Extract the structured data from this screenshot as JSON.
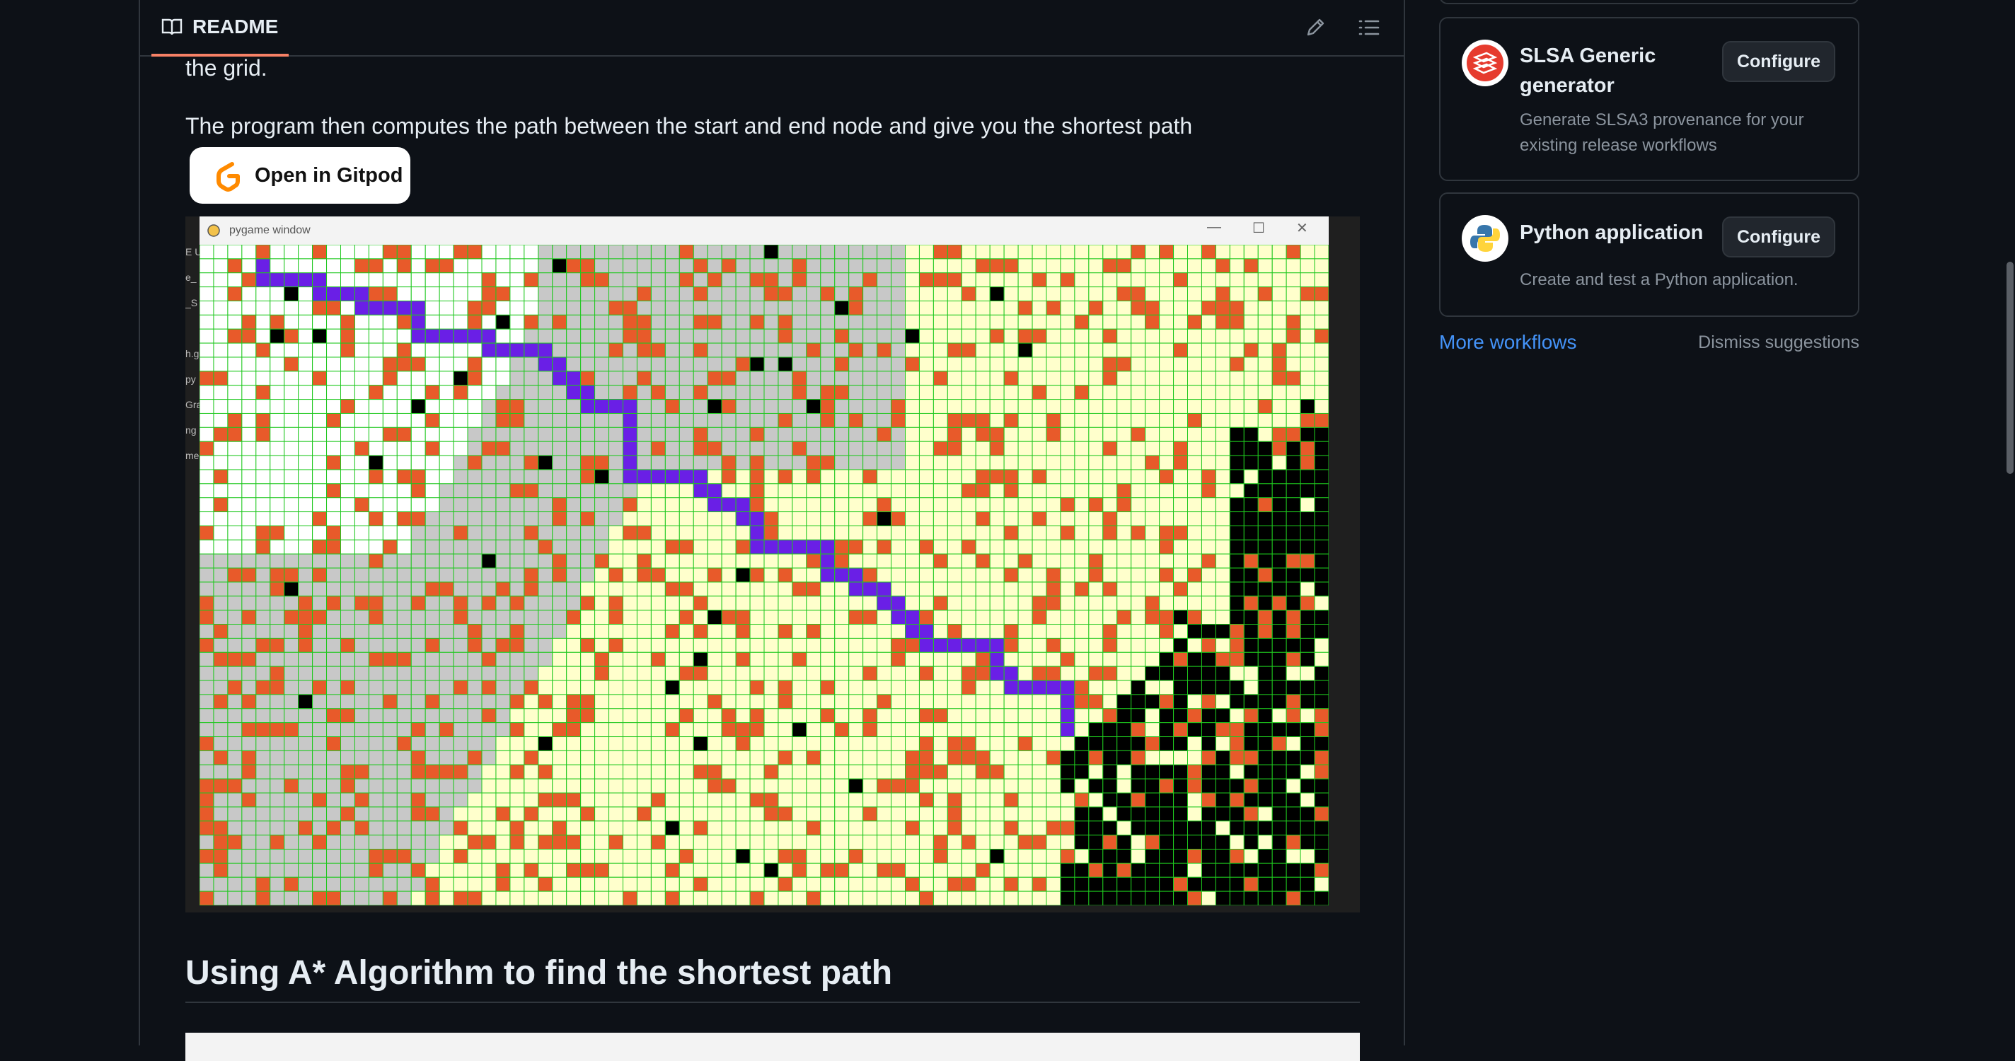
{
  "readme": {
    "tab_label": "README",
    "para1": "the grid.",
    "para2": "The program then computes the path between the start and end node and give you the shortest path",
    "gitpod_label": "Open in Gitpod",
    "screenshot": {
      "window_title": "pygame window",
      "side_labels": [
        "E U",
        "e_",
        "_S",
        "",
        "h.g",
        "py",
        "Gra",
        "ng",
        "me"
      ],
      "cols": 80,
      "rows": 47,
      "colors": {
        "open": "#ffffcc",
        "unvisited": "#ffffff",
        "visited": "#c8c8c8",
        "barrier": "#e85a2a",
        "closed": "#000000",
        "path": "#6a1fe6",
        "gridline": "#1ec81e"
      },
      "path_cells": [
        [
          4,
          1
        ],
        [
          4,
          2
        ],
        [
          5,
          2
        ],
        [
          6,
          2
        ],
        [
          7,
          2
        ],
        [
          8,
          2
        ],
        [
          8,
          3
        ],
        [
          9,
          3
        ],
        [
          10,
          3
        ],
        [
          11,
          3
        ],
        [
          11,
          4
        ],
        [
          12,
          4
        ],
        [
          13,
          4
        ],
        [
          14,
          4
        ],
        [
          15,
          4
        ],
        [
          15,
          5
        ],
        [
          15,
          6
        ],
        [
          16,
          6
        ],
        [
          17,
          6
        ],
        [
          18,
          6
        ],
        [
          19,
          6
        ],
        [
          20,
          6
        ],
        [
          20,
          7
        ],
        [
          21,
          7
        ],
        [
          22,
          7
        ],
        [
          23,
          7
        ],
        [
          24,
          7
        ],
        [
          24,
          8
        ],
        [
          25,
          8
        ],
        [
          25,
          9
        ],
        [
          26,
          9
        ],
        [
          26,
          10
        ],
        [
          27,
          10
        ],
        [
          27,
          11
        ],
        [
          28,
          11
        ],
        [
          29,
          11
        ],
        [
          30,
          11
        ],
        [
          30,
          12
        ],
        [
          30,
          13
        ],
        [
          30,
          14
        ],
        [
          30,
          15
        ],
        [
          30,
          16
        ],
        [
          31,
          16
        ],
        [
          32,
          16
        ],
        [
          33,
          16
        ],
        [
          34,
          16
        ],
        [
          35,
          16
        ],
        [
          35,
          17
        ],
        [
          36,
          17
        ],
        [
          36,
          18
        ],
        [
          37,
          18
        ],
        [
          38,
          18
        ],
        [
          38,
          19
        ],
        [
          39,
          19
        ],
        [
          39,
          20
        ],
        [
          39,
          21
        ],
        [
          40,
          21
        ],
        [
          41,
          21
        ],
        [
          42,
          21
        ],
        [
          43,
          21
        ],
        [
          44,
          21
        ],
        [
          44,
          22
        ],
        [
          44,
          23
        ],
        [
          45,
          23
        ],
        [
          46,
          23
        ],
        [
          46,
          24
        ],
        [
          47,
          24
        ],
        [
          48,
          24
        ],
        [
          48,
          25
        ],
        [
          49,
          25
        ],
        [
          49,
          26
        ],
        [
          50,
          26
        ],
        [
          50,
          27
        ],
        [
          51,
          27
        ],
        [
          51,
          28
        ],
        [
          52,
          28
        ],
        [
          53,
          28
        ],
        [
          54,
          28
        ],
        [
          55,
          28
        ],
        [
          56,
          28
        ],
        [
          56,
          29
        ],
        [
          56,
          30
        ],
        [
          57,
          30
        ],
        [
          57,
          31
        ],
        [
          58,
          31
        ],
        [
          59,
          31
        ],
        [
          60,
          31
        ],
        [
          61,
          31
        ],
        [
          61,
          32
        ],
        [
          61,
          33
        ],
        [
          61,
          34
        ]
      ]
    },
    "heading2": "Using A* Algorithm to find the shortest path"
  },
  "sidebar": {
    "cards": [
      {
        "title": "SLSA Generic generator",
        "title_line1": "SLSA Generic",
        "title_line2": "generator",
        "desc_line1": "Generate SLSA3 provenance for your",
        "desc_line2": "existing release workflows",
        "button": "Configure",
        "icon": "slsa-logo-icon"
      },
      {
        "title": "Python application",
        "desc": "Create and test a Python application.",
        "button": "Configure",
        "icon": "python-logo-icon"
      }
    ],
    "more_workflows": "More workflows",
    "dismiss": "Dismiss suggestions"
  }
}
